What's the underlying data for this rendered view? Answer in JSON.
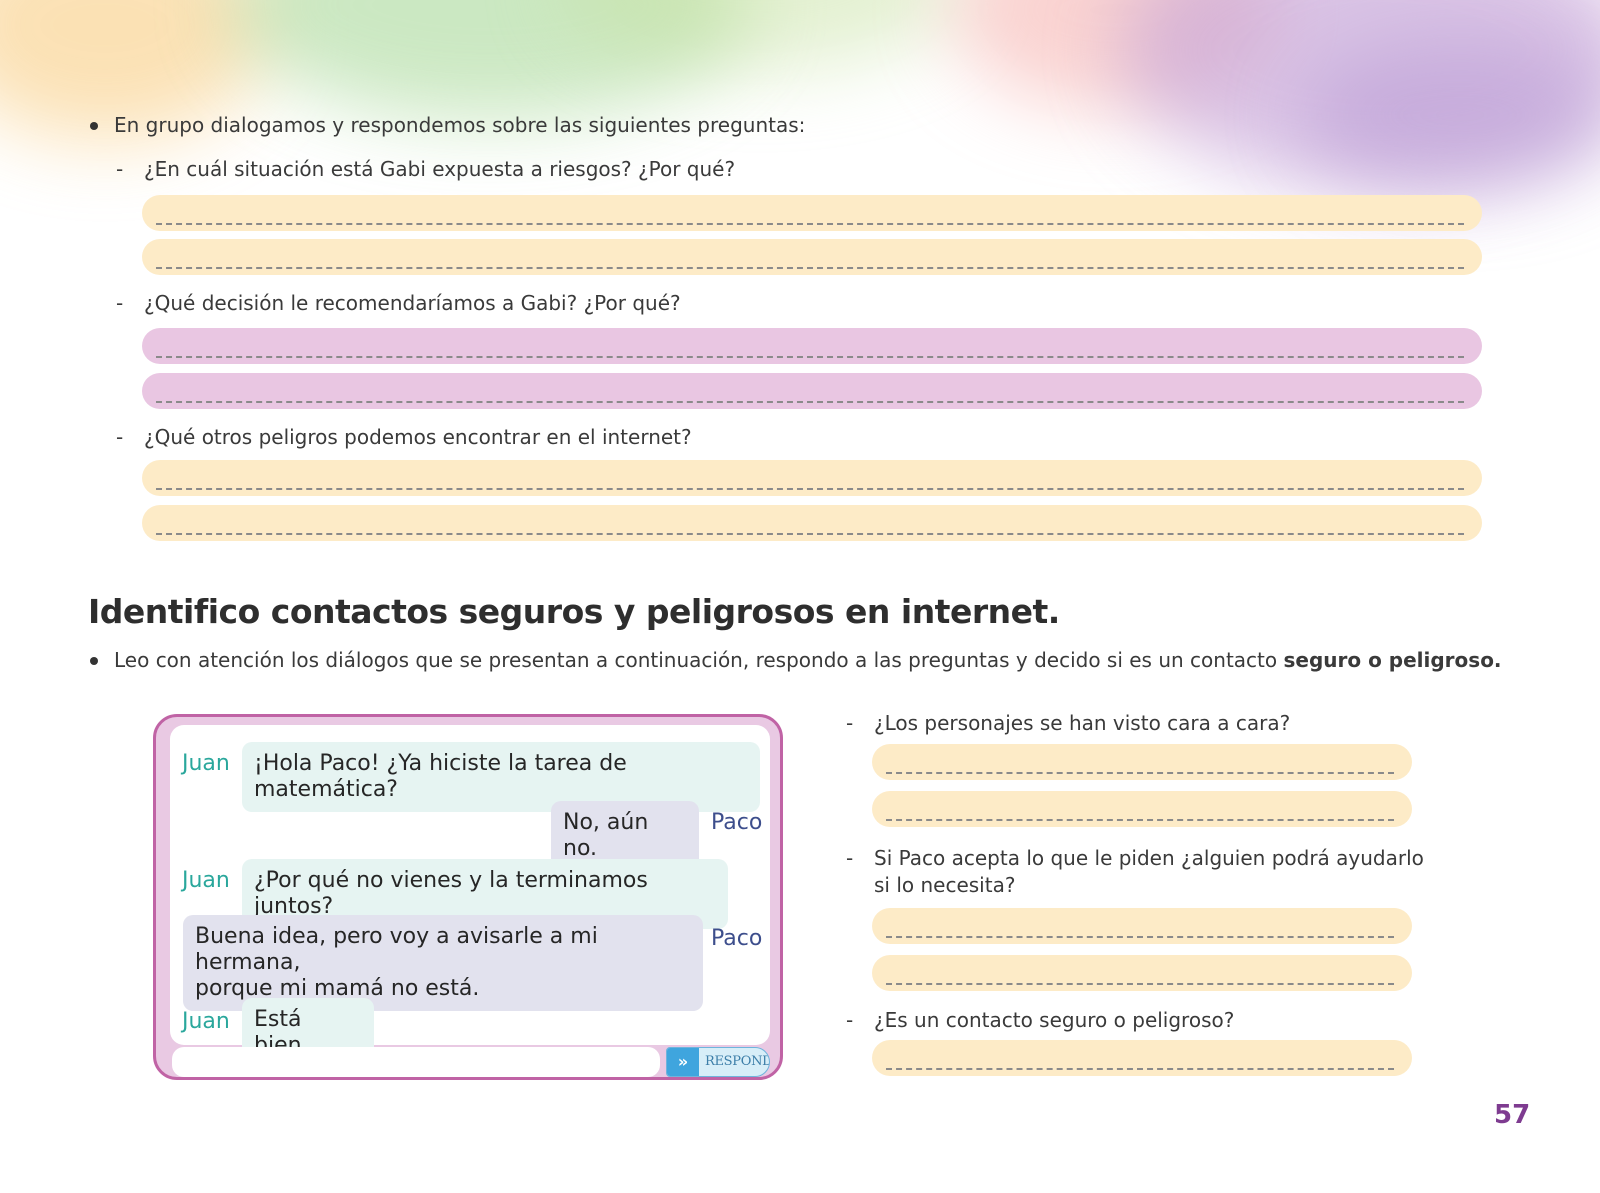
{
  "section1": {
    "intro": "En grupo dialogamos y respondemos sobre las siguientes preguntas:",
    "q1": "¿En cuál situación está Gabi expuesta a riesgos? ¿Por qué?",
    "q2": "¿Qué decisión le recomendaríamos a Gabi? ¿Por qué?",
    "q3": "¿Qué otros peligros podemos encontrar en el internet?"
  },
  "section2": {
    "heading": "Identifico contactos seguros y peligrosos en internet.",
    "instruction_start": "Leo con atención los diálogos que se presentan a continuación, respondo a las preguntas y decido si es un contacto ",
    "instruction_bold": "seguro o peligroso."
  },
  "chat": {
    "messages": [
      {
        "speaker": "Juan",
        "text": "¡Hola Paco! ¿Ya hiciste la tarea de matemática?"
      },
      {
        "speaker": "Paco",
        "text": "No, aún no."
      },
      {
        "speaker": "Juan",
        "text": "¿Por qué no vienes y la terminamos juntos?"
      },
      {
        "speaker": "Paco",
        "line1": "Buena idea, pero voy a avisarle a mi hermana,",
        "line2": "porque mi mamá no está."
      },
      {
        "speaker": "Juan",
        "text": "Está bien."
      }
    ],
    "send_label": "RESPONDER"
  },
  "side_questions": {
    "q1": "¿Los personajes se han visto cara a cara?",
    "q2_line1": "Si Paco acepta lo que le piden ¿alguien podrá ayudarlo",
    "q2_line2": "si lo necesita?",
    "q3": "¿Es un contacto seguro o peligroso?"
  },
  "page_number": "57",
  "colors": {
    "yellow_band": "#fdebc7",
    "pink_band": "#e9c6e2",
    "chat_border": "#c063a5",
    "juan": "#2aa79c",
    "paco": "#3d4e8c",
    "page_number": "#7e3b90"
  }
}
